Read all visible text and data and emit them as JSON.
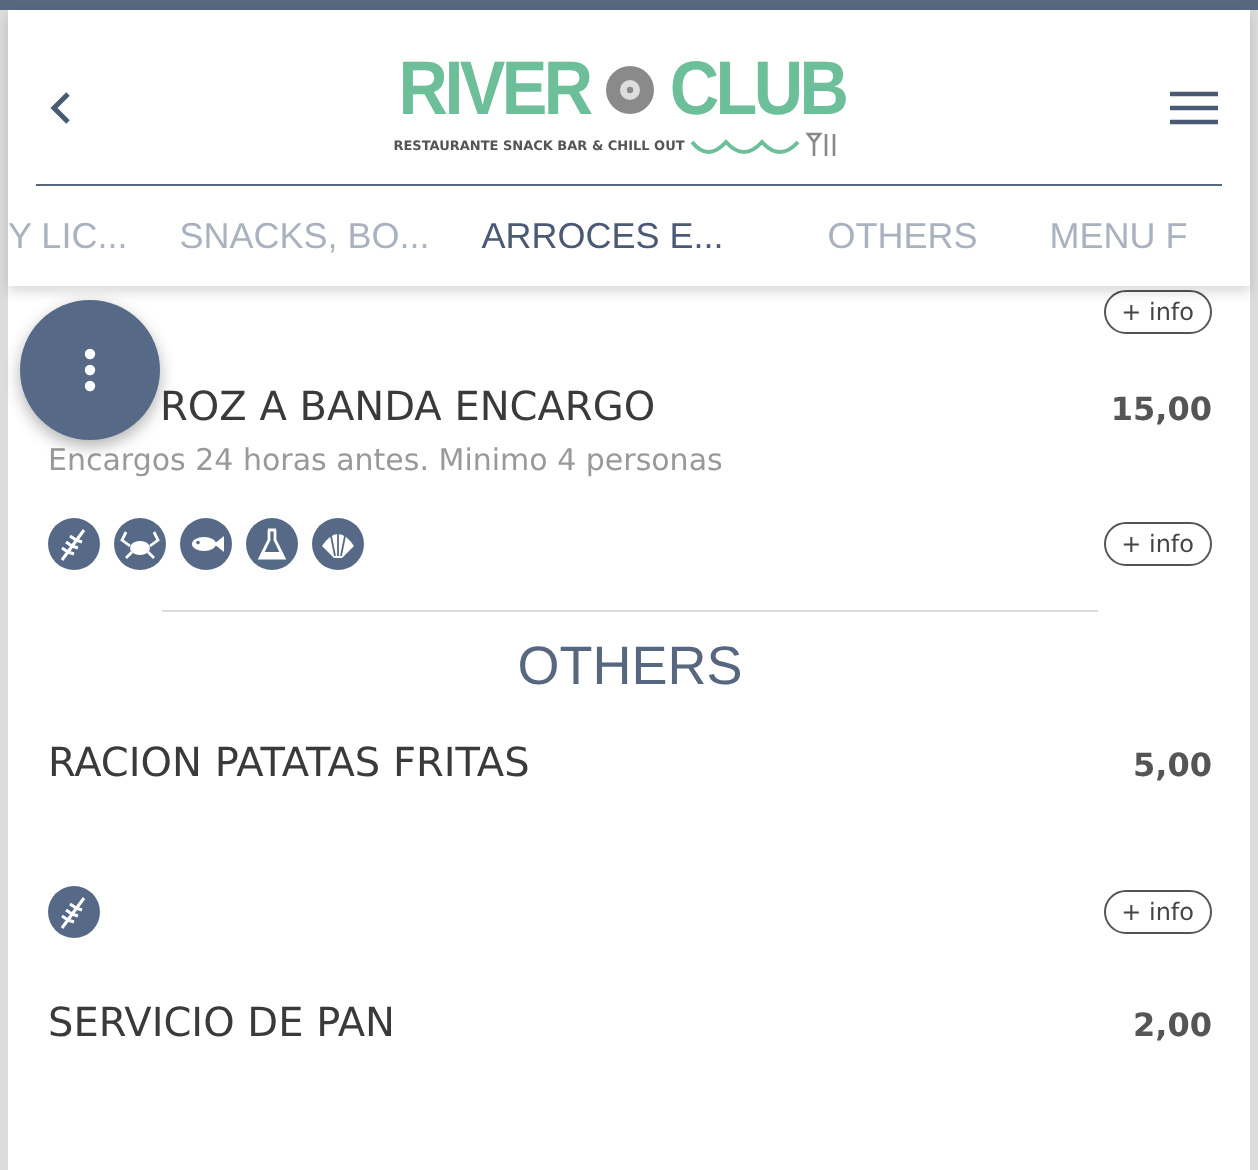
{
  "header": {
    "logo": {
      "word_1": "RIVER",
      "word_2": "CLUB",
      "tagline": "RESTAURANTE SNACK BAR & CHILL OUT"
    }
  },
  "tabs": [
    {
      "label": "Y LIC...",
      "selected": false
    },
    {
      "label": "SNACKS, BO...",
      "selected": false
    },
    {
      "label": "ARROCES E...",
      "selected": true
    },
    {
      "label": "OTHERS",
      "selected": false
    },
    {
      "label": "MENU F",
      "selected": false
    }
  ],
  "content": [
    {
      "kind": "tail",
      "info": "+ info"
    },
    {
      "kind": "dish",
      "name": "ROZ A BANDA ENCARGO",
      "price": "15,00",
      "note": "Encargos 24 horas antes. Minimo 4 personas",
      "allergens": [
        {
          "kind": "gluten"
        },
        {
          "kind": "crustaceans"
        },
        {
          "kind": "fish"
        },
        {
          "kind": "sulphites"
        },
        {
          "kind": "molluscs"
        }
      ],
      "info": "+ info"
    },
    {
      "kind": "heading",
      "title": "OTHERS"
    },
    {
      "kind": "dish",
      "name": "RACION PATATAS FRITAS",
      "price": "5,00",
      "allergens": [
        {
          "kind": "gluten"
        }
      ],
      "info": "+ info"
    },
    {
      "kind": "dish",
      "name": "SERVICIO DE PAN",
      "price": "2,00"
    }
  ]
}
